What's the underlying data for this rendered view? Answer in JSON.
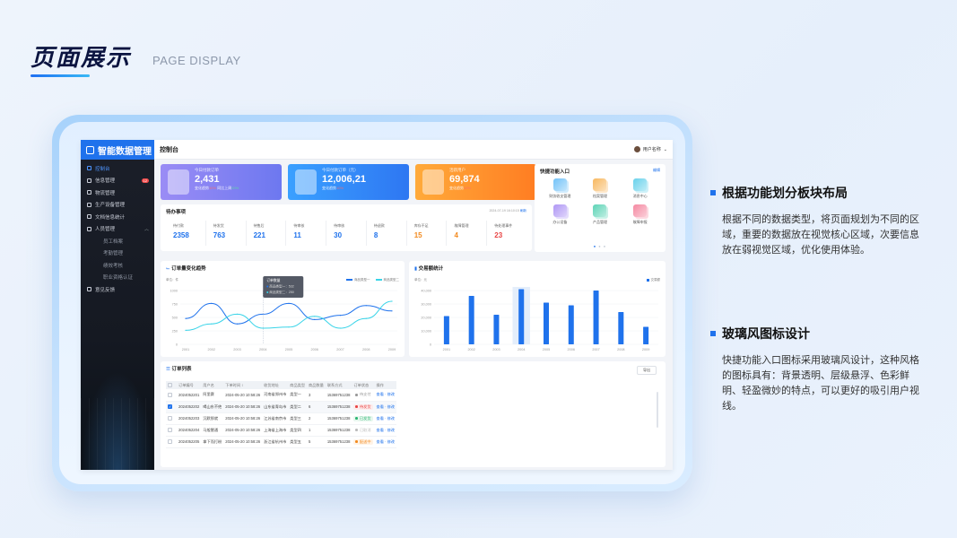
{
  "header": {
    "title": "页面展示",
    "subtitle": "PAGE DISPLAY"
  },
  "app": {
    "name": "智能数据管理",
    "page": "控制台",
    "user": "用户名称"
  },
  "sidebar": {
    "items": [
      {
        "label": "控制台",
        "active": true
      },
      {
        "label": "信息管理",
        "badge": "12"
      },
      {
        "label": "物流管理"
      },
      {
        "label": "生产设备管理"
      },
      {
        "label": "文档信息统计"
      },
      {
        "label": "人员管理",
        "expanded": true
      },
      {
        "label": "员工档案",
        "sub": true
      },
      {
        "label": "考勤管理",
        "sub": true
      },
      {
        "label": "绩效考核",
        "sub": true
      },
      {
        "label": "职业资格认证",
        "sub": true
      },
      {
        "label": "意见反馈"
      }
    ]
  },
  "stats": [
    {
      "label": "今日付款订单",
      "value": "2,431",
      "foot_l": "变化趋势",
      "chg_l": "10%",
      "foot_r": "同比上周",
      "chg_r": "20%",
      "color1": "#9a8cf5",
      "color2": "#6d78f0"
    },
    {
      "label": "今日付款订单（元）",
      "value": "12,006,21",
      "foot_l": "变化趋势",
      "chg_l": "10%",
      "color1": "#3aa0ff",
      "color2": "#2e77f2"
    },
    {
      "label": "活跃用户",
      "value": "69,874",
      "foot_l": "变化趋势",
      "chg_l": "10%",
      "color1": "#ffaa3a",
      "color2": "#ff7d22"
    }
  ],
  "todo": {
    "title": "待办事项",
    "date": "2024-07-19 16:10:15",
    "refresh": "刷新",
    "items": [
      {
        "label": "待付款",
        "value": "2358",
        "color": "#1f72ec"
      },
      {
        "label": "待发货",
        "value": "763",
        "color": "#1f72ec"
      },
      {
        "label": "待售后",
        "value": "221",
        "color": "#1f72ec"
      },
      {
        "label": "待审核",
        "value": "11",
        "color": "#1f72ec"
      },
      {
        "label": "待审核",
        "value": "30",
        "color": "#1f72ec"
      },
      {
        "label": "待退款",
        "value": "8",
        "color": "#1f72ec"
      },
      {
        "label": "库存不足",
        "value": "15",
        "color": "#f28a1f"
      },
      {
        "label": "故障管理",
        "value": "4",
        "color": "#f28a1f"
      },
      {
        "label": "待处理事件",
        "value": "23",
        "color": "#e84545"
      }
    ]
  },
  "quick": {
    "title": "快捷功能入口",
    "edit": "编辑",
    "items": [
      {
        "label": "财务收支管理",
        "icon": "finance-icon",
        "color": "#4fb3f6"
      },
      {
        "label": "档案管理",
        "icon": "folder-icon",
        "color": "#f6a637"
      },
      {
        "label": "消息中心",
        "icon": "message-icon",
        "color": "#43c6e6"
      },
      {
        "label": "办公设备",
        "icon": "device-icon",
        "color": "#9b7cf2"
      },
      {
        "label": "产品管理",
        "icon": "product-icon",
        "color": "#35c9a4"
      },
      {
        "label": "故障申报",
        "icon": "fault-icon",
        "color": "#f26b8a"
      }
    ]
  },
  "order_trend": {
    "title": "订单量变化趋势",
    "unit": "单位：件",
    "tooltip": {
      "title": "订单数量",
      "l1": "商品类型一：",
      "v1": "532",
      "l2": "商品类型二：",
      "v2": "250"
    }
  },
  "trade": {
    "title": "交易额统计",
    "unit": "单位：元",
    "legend": "交易额"
  },
  "chart_data": [
    {
      "type": "line",
      "title": "订单量变化趋势",
      "x": [
        "2001",
        "2002",
        "2003",
        "2004",
        "2005",
        "2006",
        "2007",
        "2008",
        "2009"
      ],
      "ylim": [
        0,
        1000
      ],
      "yticks": [
        "1000",
        "750",
        "500",
        "250",
        "0"
      ],
      "series": [
        {
          "name": "商品类型一",
          "color": "#1f72ec",
          "values": [
            480,
            760,
            380,
            560,
            760,
            460,
            540,
            720,
            620
          ]
        },
        {
          "name": "商品类型二",
          "color": "#39d4e8",
          "values": [
            260,
            380,
            560,
            300,
            320,
            520,
            300,
            480,
            800
          ]
        }
      ]
    },
    {
      "type": "bar",
      "title": "交易额统计",
      "x": [
        "2001",
        "2002",
        "2003",
        "2004",
        "2005",
        "2006",
        "2007",
        "2008",
        "2009"
      ],
      "ylim": [
        0,
        40000
      ],
      "yticks": [
        "40,000",
        "30,000",
        "20,000",
        "10,000",
        "0"
      ],
      "series": [
        {
          "name": "交易额",
          "color": "#1f72ec",
          "values": [
            21000,
            36000,
            22000,
            41000,
            31000,
            29000,
            40000,
            24000,
            13000
          ]
        }
      ]
    }
  ],
  "orders": {
    "title": "订单列表",
    "export": "导出",
    "columns": [
      "订单编号",
      "用户名",
      "下单时间 ↕",
      "收货地址",
      "商品类型",
      "商品数量",
      "联系方式",
      "订单状态",
      "操作"
    ],
    "rows": [
      {
        "id": "2024052201",
        "user": "阿里赛",
        "time": "2024-05-20 10:58:26",
        "addr": "河南省郑州市",
        "type": "类型一",
        "qty": "3",
        "phone": "15369751238",
        "status": "待支付",
        "scolor": "#999",
        "sbg": "transparent",
        "op": "查看 · 修改",
        "checked": false
      },
      {
        "id": "2024052202",
        "user": "喝山东不绝",
        "time": "2024-05-20 10:58:26",
        "addr": "山东省青岛市",
        "type": "类型二",
        "qty": "6",
        "phone": "15369751238",
        "status": "待发货",
        "scolor": "#e84545",
        "sbg": "#fdecec",
        "op": "查看 · 修改",
        "checked": true
      },
      {
        "id": "2024052203",
        "user": "沉默那就",
        "time": "2024-05-20 10:58:26",
        "addr": "江苏省南京市",
        "type": "类型三",
        "qty": "2",
        "phone": "15369751238",
        "status": "已发货",
        "scolor": "#2bb673",
        "sbg": "#e7f7ee",
        "op": "查看 · 修改",
        "checked": false
      },
      {
        "id": "2024052204",
        "user": "马般慧通",
        "time": "2024-05-20 10:58:26",
        "addr": "上海省上海市",
        "type": "类型四",
        "qty": "1",
        "phone": "15369751238",
        "status": "已取消",
        "scolor": "#bbb",
        "sbg": "transparent",
        "op": "查看 · 修改",
        "checked": false
      },
      {
        "id": "2024052205",
        "user": "拿下而打粉",
        "time": "2024-05-20 10:58:26",
        "addr": "浙江省杭州市",
        "type": "类型五",
        "qty": "5",
        "phone": "15369751238",
        "status": "配送中",
        "scolor": "#f28a1f",
        "sbg": "#fff3e6",
        "op": "查看 · 修改",
        "checked": false
      }
    ]
  },
  "features": [
    {
      "title": "根据功能划分板块布局",
      "text": "根据不同的数据类型，将页面规划为不同的区域，重要的数据放在视觉核心区域，次要信息放在弱视觉区域，优化使用体验。"
    },
    {
      "title": "玻璃风图标设计",
      "text": "快捷功能入口图标采用玻璃风设计，这种风格的图标具有：背景透明、层级悬浮、色彩鲜明、轻盈微妙的特点，可以更好的吸引用户视线。"
    }
  ]
}
